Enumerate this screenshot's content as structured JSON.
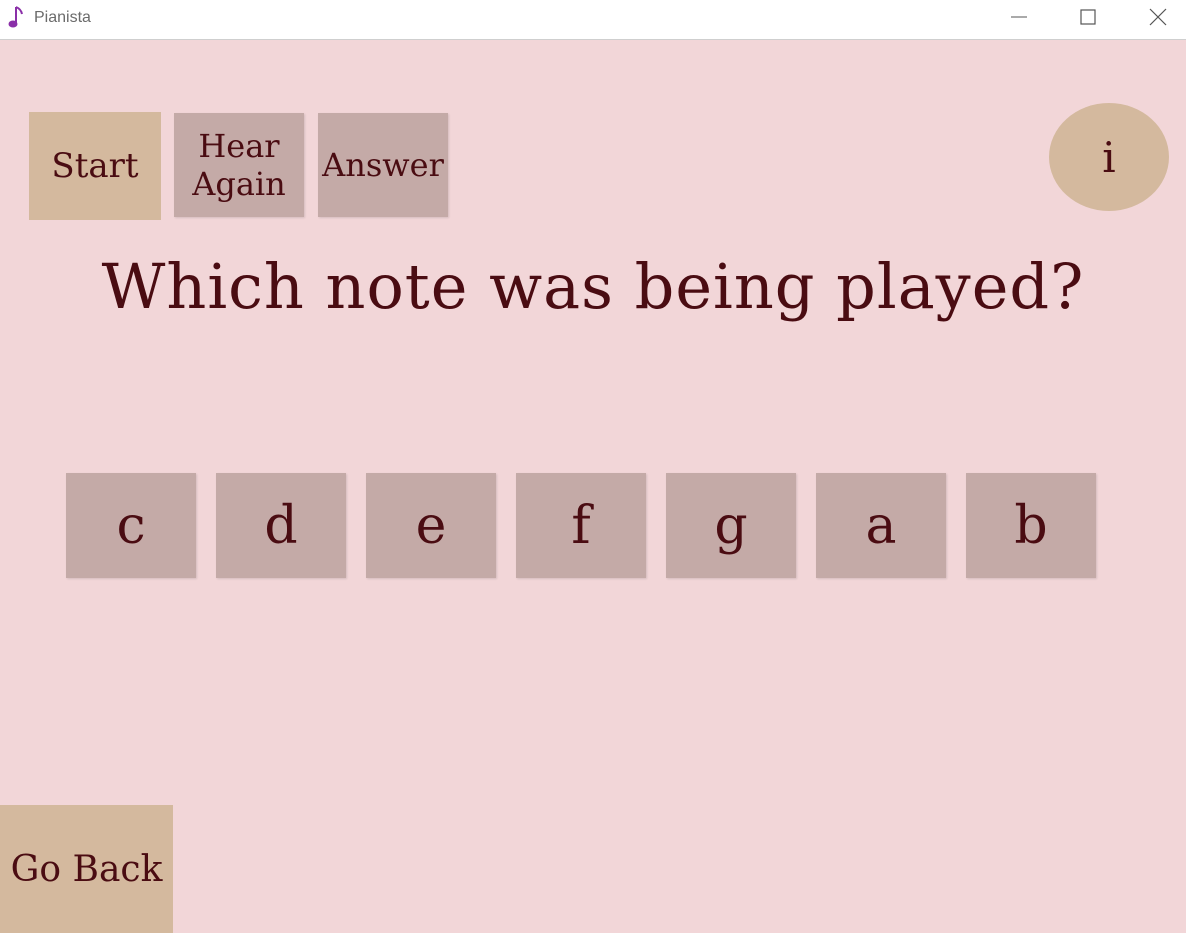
{
  "window": {
    "title": "Pianista",
    "icons": {
      "app": "music-note-icon",
      "minimize": "minimize-icon",
      "maximize": "maximize-icon",
      "close": "close-icon"
    }
  },
  "colors": {
    "background": "#f2d6d8",
    "button_muted": "#c4aaa7",
    "button_tan": "#d4b99e",
    "text": "#4a0c12",
    "app_icon": "#8a2fa8"
  },
  "toolbar": {
    "start_label": "Start",
    "hear_again_line1": "Hear",
    "hear_again_line2": "Again",
    "answer_label": "Answer",
    "info_label": "i"
  },
  "question": "Which note was being played?",
  "notes": [
    "c",
    "d",
    "e",
    "f",
    "g",
    "a",
    "b"
  ],
  "footer": {
    "back_label": "Go Back"
  }
}
